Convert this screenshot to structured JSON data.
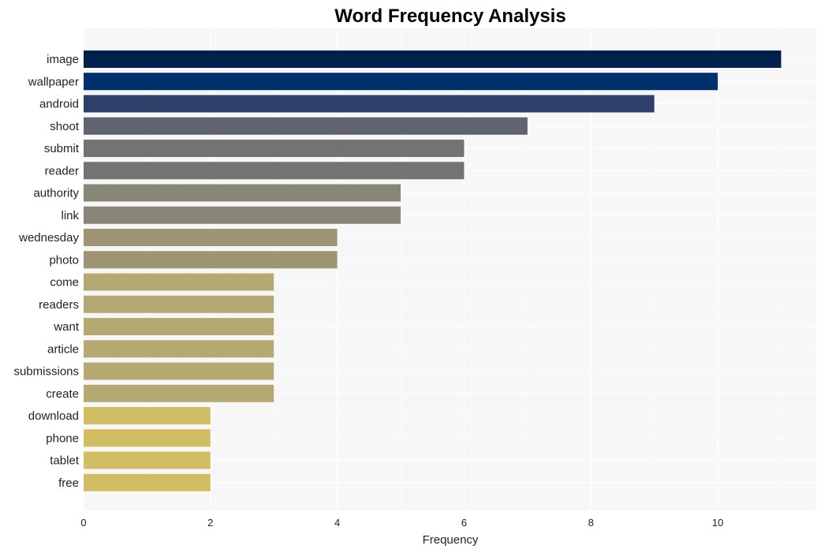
{
  "chart_data": {
    "type": "bar",
    "orientation": "horizontal",
    "title": "Word Frequency Analysis",
    "xlabel": "Frequency",
    "ylabel": "",
    "xlim": [
      0,
      11.55
    ],
    "xticks": [
      0,
      2,
      4,
      6,
      8,
      10
    ],
    "grid": true,
    "legend": "none",
    "categories": [
      "image",
      "wallpaper",
      "android",
      "shoot",
      "submit",
      "reader",
      "authority",
      "link",
      "wednesday",
      "photo",
      "come",
      "readers",
      "want",
      "article",
      "submissions",
      "create",
      "download",
      "phone",
      "tablet",
      "free"
    ],
    "values": [
      11,
      10,
      9,
      7,
      6,
      6,
      5,
      5,
      4,
      4,
      3,
      3,
      3,
      3,
      3,
      3,
      2,
      2,
      2,
      2
    ],
    "colors": [
      "#00204e",
      "#01306f",
      "#2f416b",
      "#5f6470",
      "#737373",
      "#737373",
      "#888677",
      "#888677",
      "#9e9574",
      "#9e9574",
      "#b6a871",
      "#b6a871",
      "#b6a871",
      "#b6a871",
      "#b6a871",
      "#b6a871",
      "#d0bd64",
      "#d0bd64",
      "#d0bd64",
      "#d0bd64"
    ],
    "background": "#f7f7f7"
  }
}
